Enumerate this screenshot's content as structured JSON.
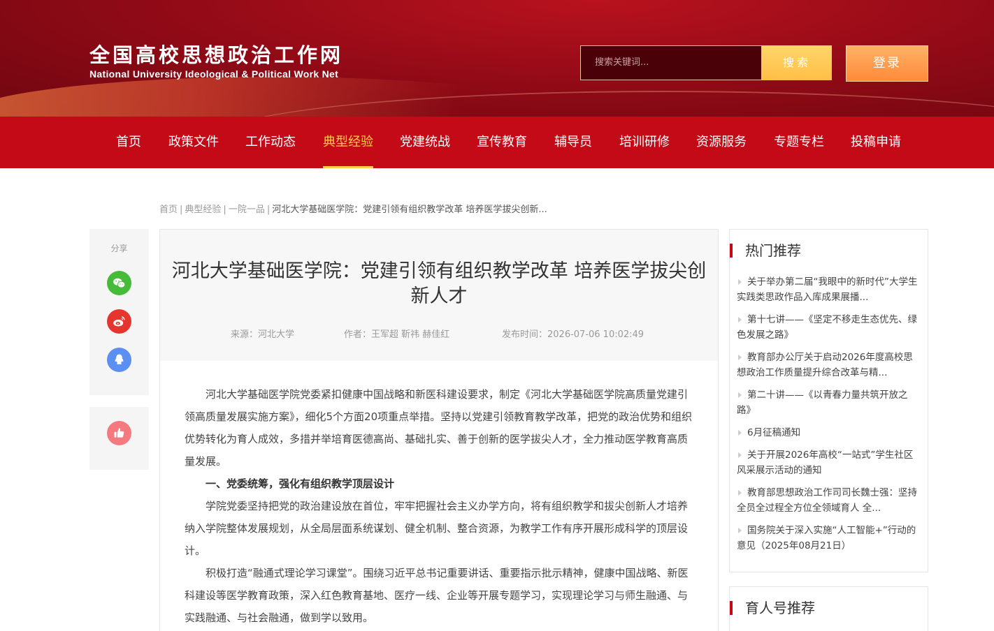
{
  "header": {
    "logo_cn": "全国高校思想政治工作网",
    "logo_en": "National University Ideological & Political Work Net",
    "search_placeholder": "搜索关键词...",
    "search_button": "搜索",
    "login_button": "登录"
  },
  "nav": {
    "items": [
      "首页",
      "政策文件",
      "工作动态",
      "典型经验",
      "党建统战",
      "宣传教育",
      "辅导员",
      "培训研修",
      "资源服务",
      "专题专栏",
      "投稿申请"
    ],
    "active": "典型经验"
  },
  "breadcrumb": [
    "首页",
    "典型经验",
    "一院一品",
    "河北大学基础医学院：党建引领有组织教学改革 培养医学拔尖创新..."
  ],
  "share": {
    "label": "分享",
    "icons": [
      "wechat-icon",
      "weibo-icon",
      "qq-icon",
      "thumbs-up-icon"
    ]
  },
  "article": {
    "title": "河北大学基础医学院：党建引领有组织教学改革 培养医学拔尖创新人才",
    "source": "来源：河北大学",
    "author": "作者：王军超 靳祎 赫佳红",
    "publish_time": "发布时间：2026-07-06 10:02:49",
    "paragraphs": [
      "河北大学基础医学院党委紧扣健康中国战略和新医科建设要求，制定《河北大学基础医学院高质量党建引领高质量发展实施方案》，细化5个方面20项重点举措。坚持以党建引领教育教学改革，把党的政治优势和组织优势转化为育人成效，多措并举培育医德高尚、基础扎实、善于创新的医学拔尖人才，全力推动医学教育高质量发展。",
      "一、党委统筹，强化有组织教学顶层设计",
      "学院党委坚持把党的政治建设放在首位，牢牢把握社会主义办学方向，将有组织教学和拔尖创新人才培养纳入学院整体发展规划，从全局层面系统谋划、健全机制、整合资源，为教学工作有序开展形成科学的顶层设计。",
      "积极打造“融通式理论学习课堂”。围绕习近平总书记重要讲话、重要指示批示精神，健康中国战略、新医科建设等医学教育政策，深入红色教育基地、医疗一线、企业等开展专题学习，实现理论学习与师生融通、与实践融通、与社会融通，做到学以致用。"
    ]
  },
  "sidebar": {
    "hot_title": "热门推荐",
    "hot_items": [
      "关于举办第二届“我眼中的新时代”大学生实践类思政作品入库成果展播...",
      "第十七讲——《坚定不移走生态优先、绿色发展之路》",
      "教育部办公厅关于启动2026年度高校思想政治工作质量提升综合改革与精...",
      "第二十讲——《以青春力量共筑开放之路》",
      "6月征稿通知",
      "关于开展2026年高校“一站式”学生社区风采展示活动的通知",
      "教育部思想政治工作司司长魏士强：坚持全员全过程全方位全领域育人 全...",
      "国务院关于深入实施“人工智能+”行动的意见（2025年08月21日）"
    ],
    "yuren_title": "育人号推荐"
  },
  "colors": {
    "brand_red": "#c40a16",
    "active_yellow": "#ffcf4a",
    "search_yellow": "#ffc84f",
    "login_orange": "#ff9a48"
  }
}
